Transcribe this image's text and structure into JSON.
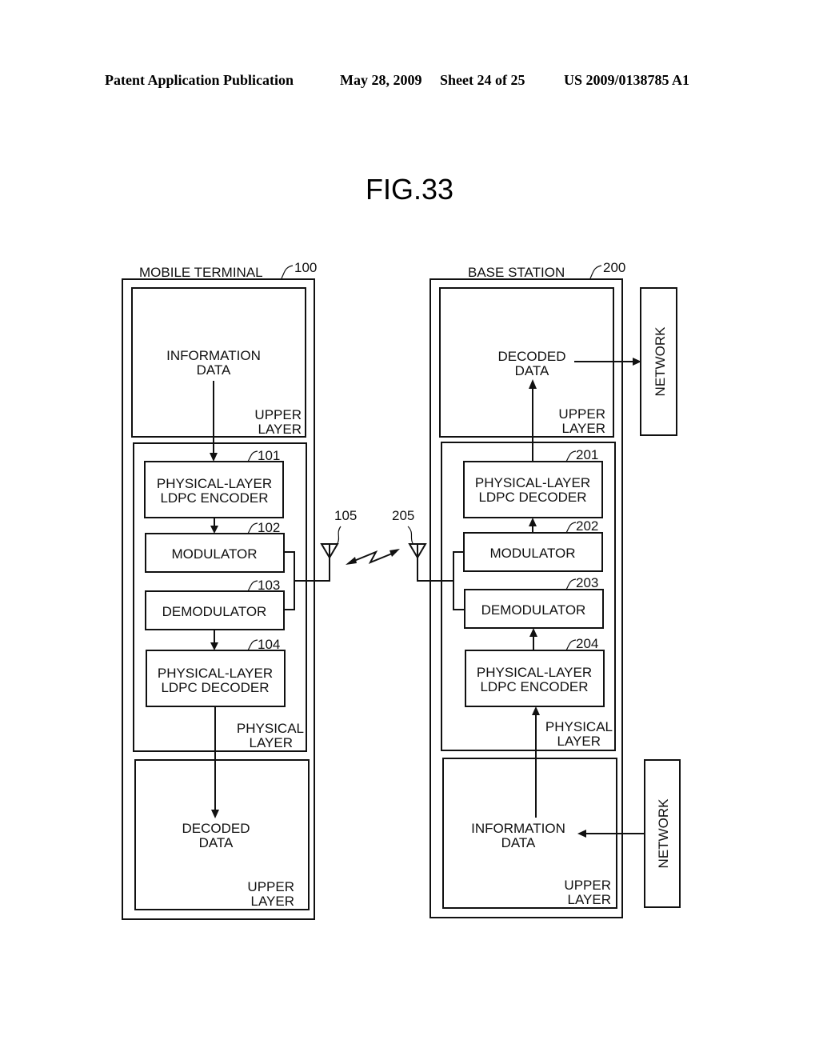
{
  "header": {
    "publication": "Patent Application Publication",
    "date": "May 28, 2009",
    "sheet": "Sheet 24 of 25",
    "number": "US 2009/0138785 A1"
  },
  "figure": {
    "title": "FIG.33",
    "mobile_terminal": {
      "label": "MOBILE TERMINAL",
      "ref": "100",
      "upper_layer_top": {
        "content_line1": "INFORMATION",
        "content_line2": "DATA",
        "layer_line1": "UPPER",
        "layer_line2": "LAYER"
      },
      "physical_layer": {
        "layer_line1": "PHYSICAL",
        "layer_line2": "LAYER",
        "blocks": [
          {
            "ref": "101",
            "line1": "PHYSICAL-LAYER",
            "line2": "LDPC ENCODER"
          },
          {
            "ref": "102",
            "line1": "MODULATOR"
          },
          {
            "ref": "103",
            "line1": "DEMODULATOR"
          },
          {
            "ref": "104",
            "line1": "PHYSICAL-LAYER",
            "line2": "LDPC DECODER"
          }
        ]
      },
      "upper_layer_bottom": {
        "content_line1": "DECODED",
        "content_line2": "DATA",
        "layer_line1": "UPPER",
        "layer_line2": "LAYER"
      },
      "antenna_ref": "105"
    },
    "base_station": {
      "label": "BASE STATION",
      "ref": "200",
      "upper_layer_top": {
        "content_line1": "DECODED",
        "content_line2": "DATA",
        "layer_line1": "UPPER",
        "layer_line2": "LAYER"
      },
      "physical_layer": {
        "layer_line1": "PHYSICAL",
        "layer_line2": "LAYER",
        "blocks": [
          {
            "ref": "201",
            "line1": "PHYSICAL-LAYER",
            "line2": "LDPC DECODER"
          },
          {
            "ref": "202",
            "line1": "MODULATOR"
          },
          {
            "ref": "203",
            "line1": "DEMODULATOR"
          },
          {
            "ref": "204",
            "line1": "PHYSICAL-LAYER",
            "line2": "LDPC ENCODER"
          }
        ]
      },
      "upper_layer_bottom": {
        "content_line1": "INFORMATION",
        "content_line2": "DATA",
        "layer_line1": "UPPER",
        "layer_line2": "LAYER"
      },
      "antenna_ref": "205"
    },
    "network_top": "NETWORK",
    "network_bottom": "NETWORK"
  }
}
